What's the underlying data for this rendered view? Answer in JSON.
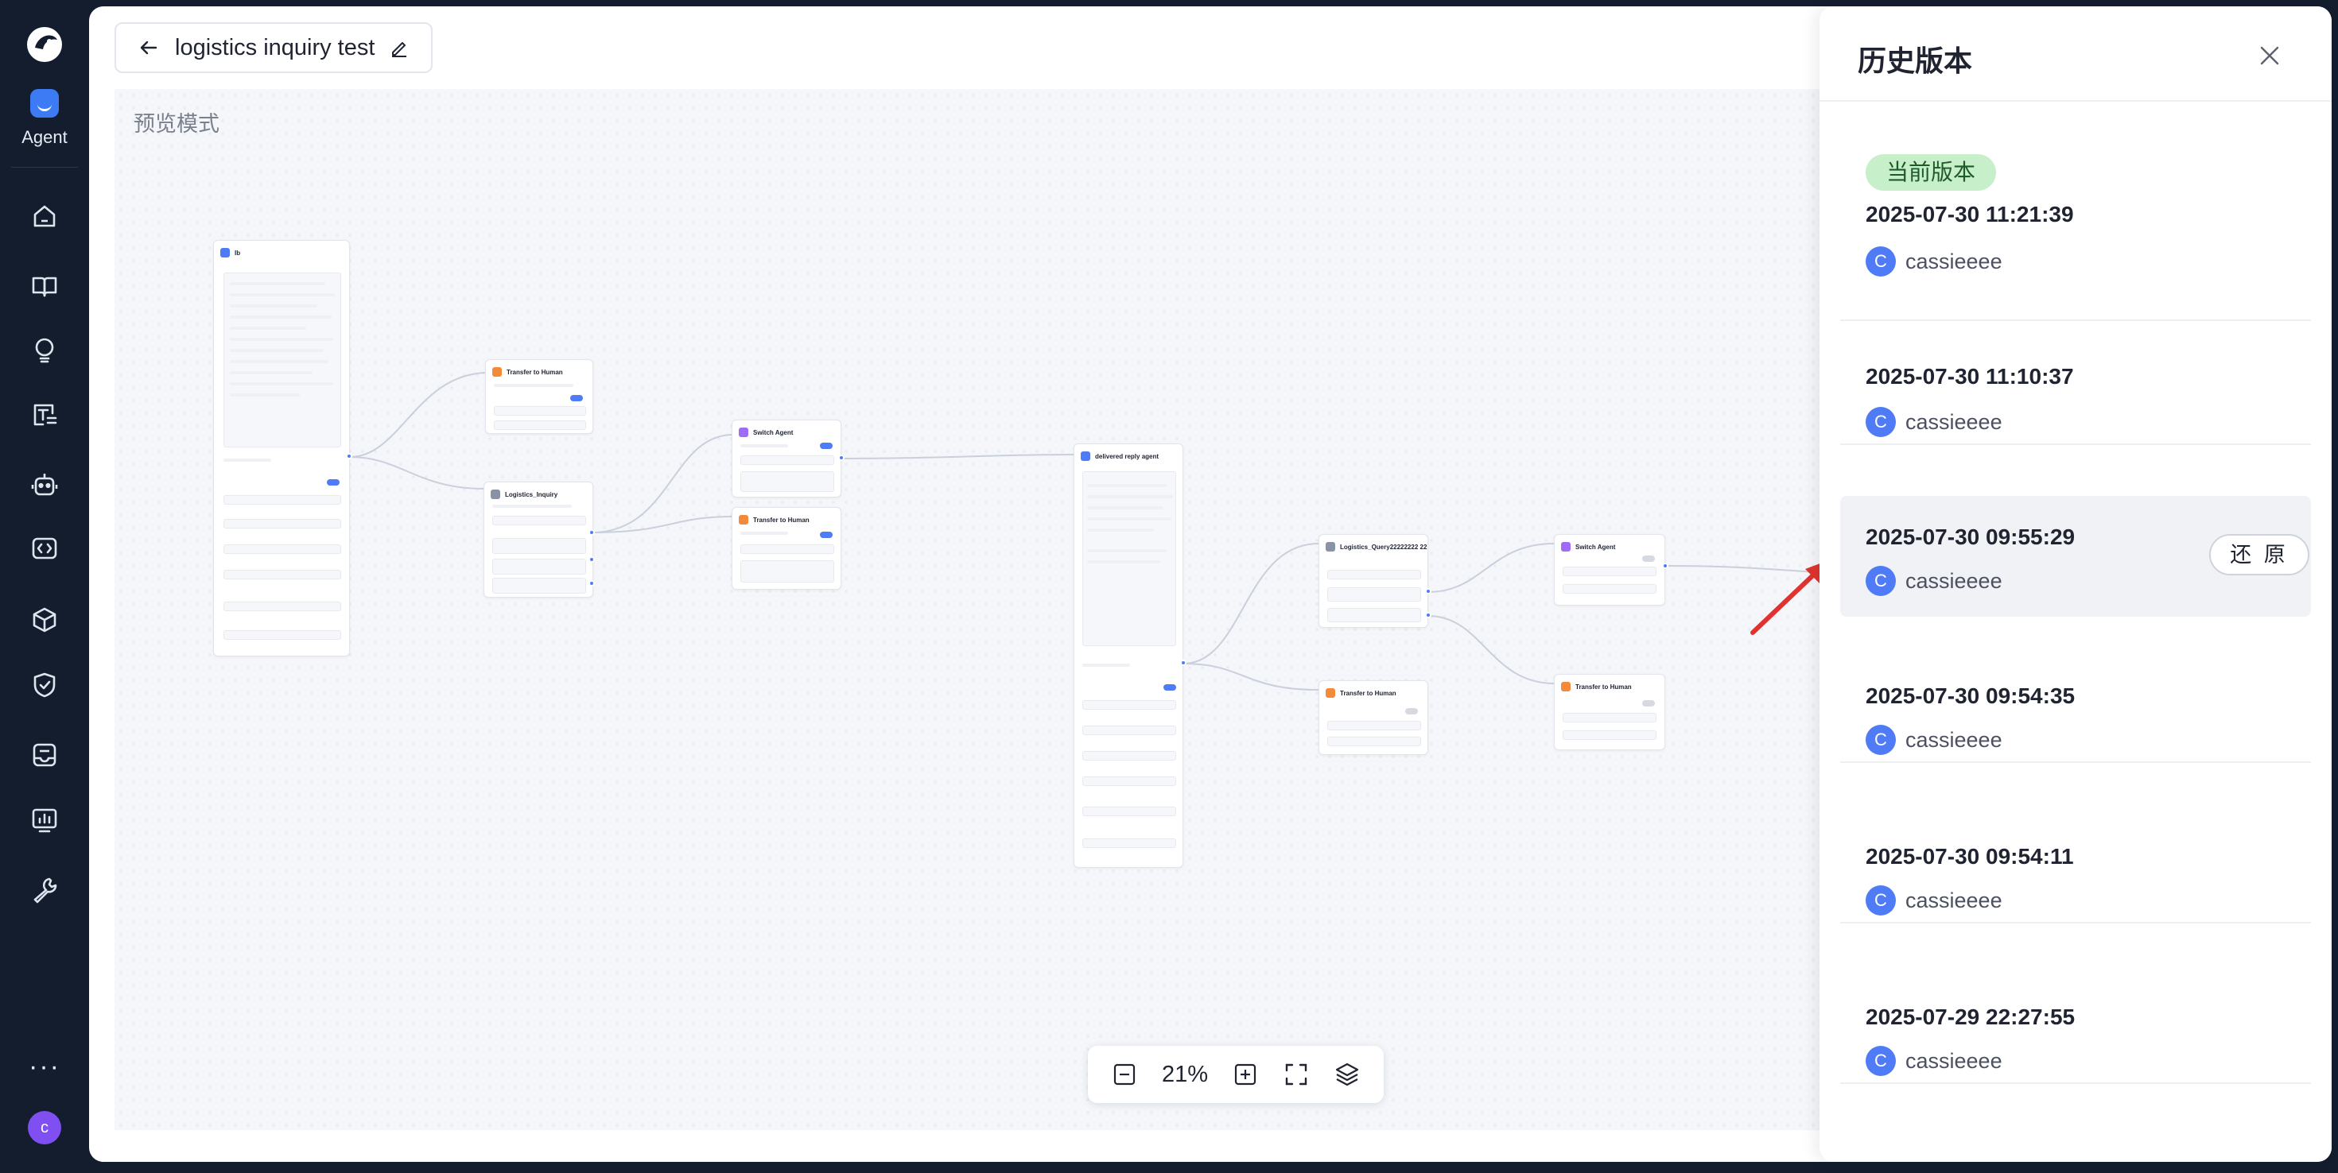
{
  "nav": {
    "agent_label": "Agent",
    "avatar_letter": "c",
    "more": "···",
    "icons": [
      "home-icon",
      "book-icon",
      "lightbulb-icon",
      "text-box-icon",
      "robot-icon",
      "code-icon",
      "cube-icon",
      "shield-check-icon",
      "inbox-icon",
      "chart-icon",
      "wrench-icon"
    ]
  },
  "header": {
    "title": "logistics inquiry test"
  },
  "canvas": {
    "mode_label": "预览模式"
  },
  "nodes": {
    "start": "Ib",
    "transfer1": "Transfer to Human",
    "logistics": "Logistics_Inquiry",
    "switch1": "Switch Agent",
    "transfer2": "Transfer to Human",
    "delivered": "delivered reply agent",
    "query": "Logistics_Query22222222 22",
    "transfer3": "Transfer to Human",
    "switch2": "Switch Agent",
    "transfer4": "Transfer to Human"
  },
  "zoom": {
    "value": "21%"
  },
  "history": {
    "title": "历史版本",
    "current_badge": "当前版本",
    "restore_label": "还 原",
    "versions": [
      {
        "time": "2025-07-30 11:21:39",
        "user": "cassieeee",
        "avatar": "C"
      },
      {
        "time": "2025-07-30 11:10:37",
        "user": "cassieeee",
        "avatar": "C"
      },
      {
        "time": "2025-07-30 09:55:29",
        "user": "cassieeee",
        "avatar": "C"
      },
      {
        "time": "2025-07-30 09:54:35",
        "user": "cassieeee",
        "avatar": "C"
      },
      {
        "time": "2025-07-30 09:54:11",
        "user": "cassieeee",
        "avatar": "C"
      },
      {
        "time": "2025-07-29 22:27:55",
        "user": "cassieeee",
        "avatar": "C"
      }
    ]
  },
  "colors": {
    "accent": "#4f7cf6",
    "nav_bg": "#131d2e",
    "badge_green": "#c7efc9",
    "arrow_red": "#e0332f"
  }
}
